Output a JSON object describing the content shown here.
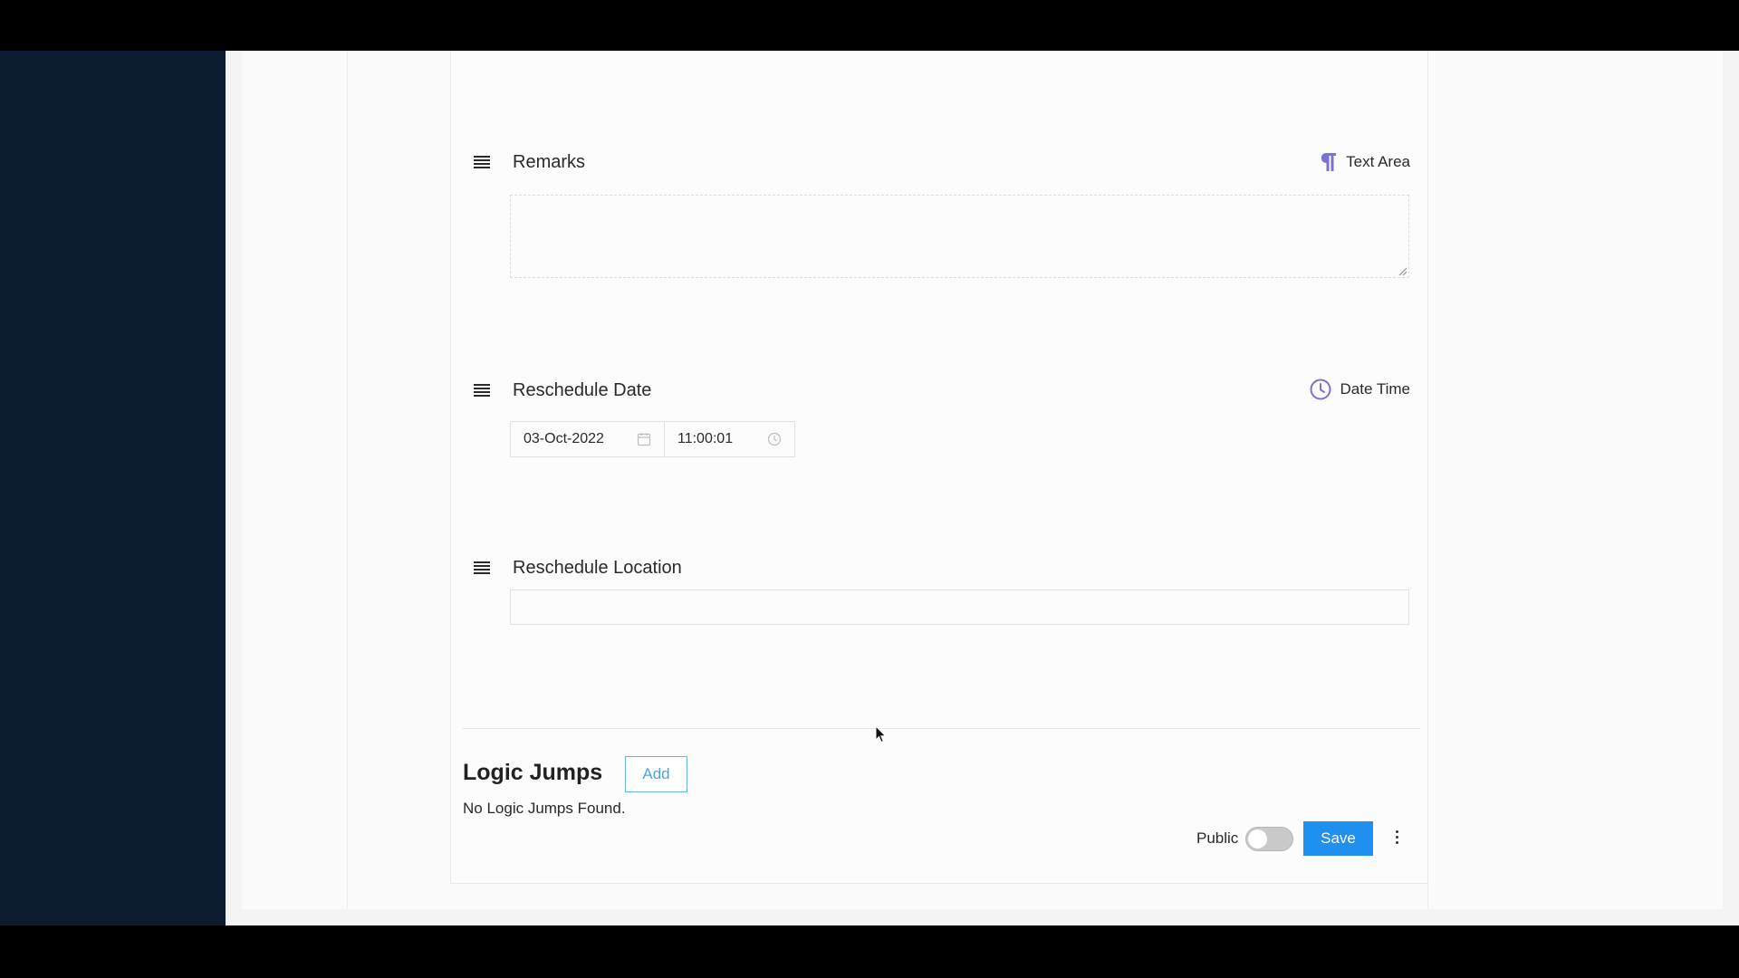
{
  "fields": {
    "remarks": {
      "label": "Remarks",
      "type_label": "Text Area",
      "value": ""
    },
    "reschedule_date": {
      "label": "Reschedule Date",
      "type_label": "Date Time",
      "date_value": "03-Oct-2022",
      "time_value": "11:00:01"
    },
    "reschedule_location": {
      "label": "Reschedule Location",
      "value": ""
    }
  },
  "logic_jumps": {
    "title": "Logic Jumps",
    "add_label": "Add",
    "empty_text": "No Logic Jumps Found."
  },
  "footer": {
    "public_label": "Public",
    "public_enabled": false,
    "save_label": "Save"
  },
  "colors": {
    "sidebar": "#0d1d31",
    "accent": "#1f8ff0",
    "icon_purple": "#7b72d4"
  }
}
